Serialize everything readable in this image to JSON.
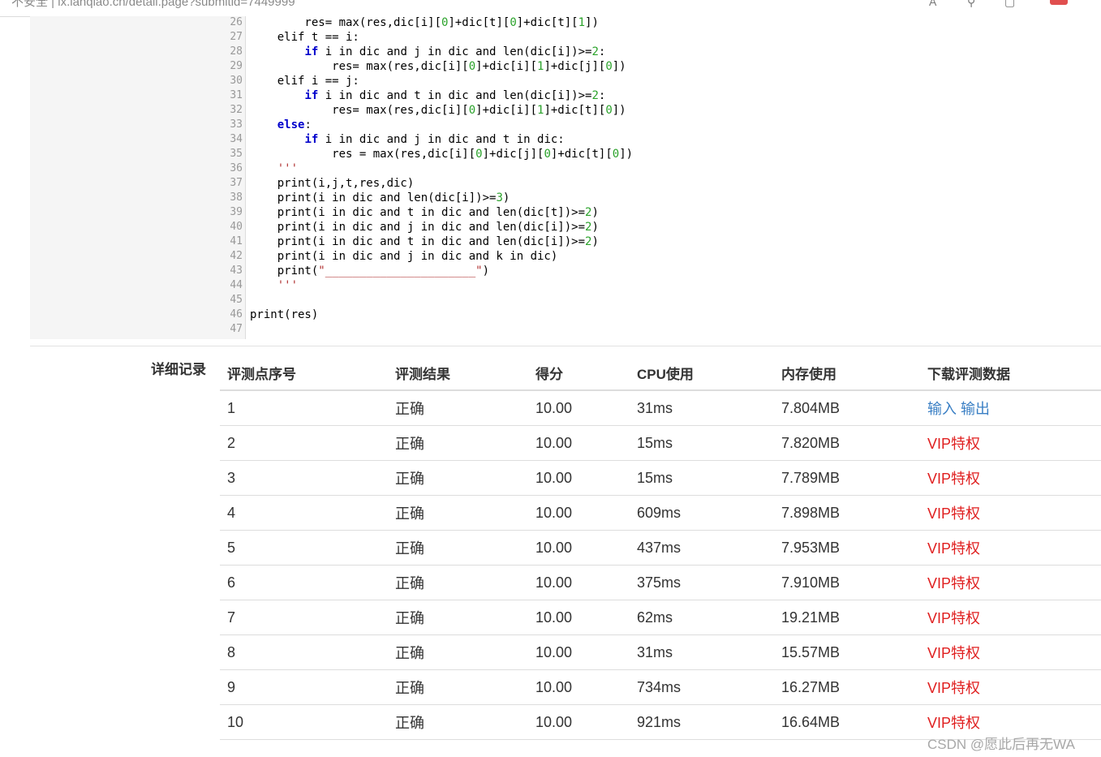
{
  "browser": {
    "url": "不安全 | lx.lanqiao.cn/detail.page?submitid=7449999"
  },
  "code": {
    "lines": [
      {
        "n": "26",
        "html": "        res= max(res,dic[i][<span class=\"nm\">0</span>]+dic[t][<span class=\"nm\">0</span>]+dic[t][<span class=\"nm\">1</span>])"
      },
      {
        "n": "27",
        "html": "    elif t == i:"
      },
      {
        "n": "28",
        "html": "        <span class=\"kw\">if</span> i in dic and j in dic and len(dic[i])&gt;=<span class=\"nm\">2</span>:"
      },
      {
        "n": "29",
        "html": "            res= max(res,dic[i][<span class=\"nm\">0</span>]+dic[i][<span class=\"nm\">1</span>]+dic[j][<span class=\"nm\">0</span>])"
      },
      {
        "n": "30",
        "html": "    elif i == j:"
      },
      {
        "n": "31",
        "html": "        <span class=\"kw\">if</span> i in dic and t in dic and len(dic[i])&gt;=<span class=\"nm\">2</span>:"
      },
      {
        "n": "32",
        "html": "            res= max(res,dic[i][<span class=\"nm\">0</span>]+dic[i][<span class=\"nm\">1</span>]+dic[t][<span class=\"nm\">0</span>])"
      },
      {
        "n": "33",
        "html": "    <span class=\"kw\">else</span>:"
      },
      {
        "n": "34",
        "html": "        <span class=\"kw\">if</span> i in dic and j in dic and t in dic:"
      },
      {
        "n": "35",
        "html": "            res = max(res,dic[i][<span class=\"nm\">0</span>]+dic[j][<span class=\"nm\">0</span>]+dic[t][<span class=\"nm\">0</span>])"
      },
      {
        "n": "36",
        "html": "    <span class=\"st\">'''</span>"
      },
      {
        "n": "37",
        "html": "    print(i,j,t,res,dic)"
      },
      {
        "n": "38",
        "html": "    print(i in dic and len(dic[i])&gt;=<span class=\"nm\">3</span>)"
      },
      {
        "n": "39",
        "html": "    print(i in dic and t in dic and len(dic[t])&gt;=<span class=\"nm\">2</span>)"
      },
      {
        "n": "40",
        "html": "    print(i in dic and j in dic and len(dic[i])&gt;=<span class=\"nm\">2</span>)"
      },
      {
        "n": "41",
        "html": "    print(i in dic and t in dic and len(dic[i])&gt;=<span class=\"nm\">2</span>)"
      },
      {
        "n": "42",
        "html": "    print(i in dic and j in dic and k in dic)"
      },
      {
        "n": "43",
        "html": "    print(<span class=\"st\">\"______________________\"</span>)"
      },
      {
        "n": "44",
        "html": "    <span class=\"st\">'''</span>"
      },
      {
        "n": "45",
        "html": ""
      },
      {
        "n": "46",
        "html": "print(res)"
      },
      {
        "n": "47",
        "html": ""
      }
    ]
  },
  "records": {
    "section_label": "详细记录",
    "headers": [
      "评测点序号",
      "评测结果",
      "得分",
      "CPU使用",
      "内存使用",
      "下载评测数据"
    ],
    "rows": [
      {
        "id": "1",
        "result": "正确",
        "score": "10.00",
        "cpu": "31ms",
        "mem": "7.804MB",
        "download": "输入 输出",
        "download_type": "link"
      },
      {
        "id": "2",
        "result": "正确",
        "score": "10.00",
        "cpu": "15ms",
        "mem": "7.820MB",
        "download": "VIP特权",
        "download_type": "vip"
      },
      {
        "id": "3",
        "result": "正确",
        "score": "10.00",
        "cpu": "15ms",
        "mem": "7.789MB",
        "download": "VIP特权",
        "download_type": "vip"
      },
      {
        "id": "4",
        "result": "正确",
        "score": "10.00",
        "cpu": "609ms",
        "mem": "7.898MB",
        "download": "VIP特权",
        "download_type": "vip"
      },
      {
        "id": "5",
        "result": "正确",
        "score": "10.00",
        "cpu": "437ms",
        "mem": "7.953MB",
        "download": "VIP特权",
        "download_type": "vip"
      },
      {
        "id": "6",
        "result": "正确",
        "score": "10.00",
        "cpu": "375ms",
        "mem": "7.910MB",
        "download": "VIP特权",
        "download_type": "vip"
      },
      {
        "id": "7",
        "result": "正确",
        "score": "10.00",
        "cpu": "62ms",
        "mem": "19.21MB",
        "download": "VIP特权",
        "download_type": "vip"
      },
      {
        "id": "8",
        "result": "正确",
        "score": "10.00",
        "cpu": "31ms",
        "mem": "15.57MB",
        "download": "VIP特权",
        "download_type": "vip"
      },
      {
        "id": "9",
        "result": "正确",
        "score": "10.00",
        "cpu": "734ms",
        "mem": "16.27MB",
        "download": "VIP特权",
        "download_type": "vip"
      },
      {
        "id": "10",
        "result": "正确",
        "score": "10.00",
        "cpu": "921ms",
        "mem": "16.64MB",
        "download": "VIP特权",
        "download_type": "vip"
      }
    ]
  },
  "watermark": "CSDN @愿此后再无WA",
  "colors": {
    "link": "#3a7fc4",
    "vip": "#e02020",
    "keyword": "#0000cc",
    "number": "#2aa22a",
    "string": "#b03030"
  }
}
